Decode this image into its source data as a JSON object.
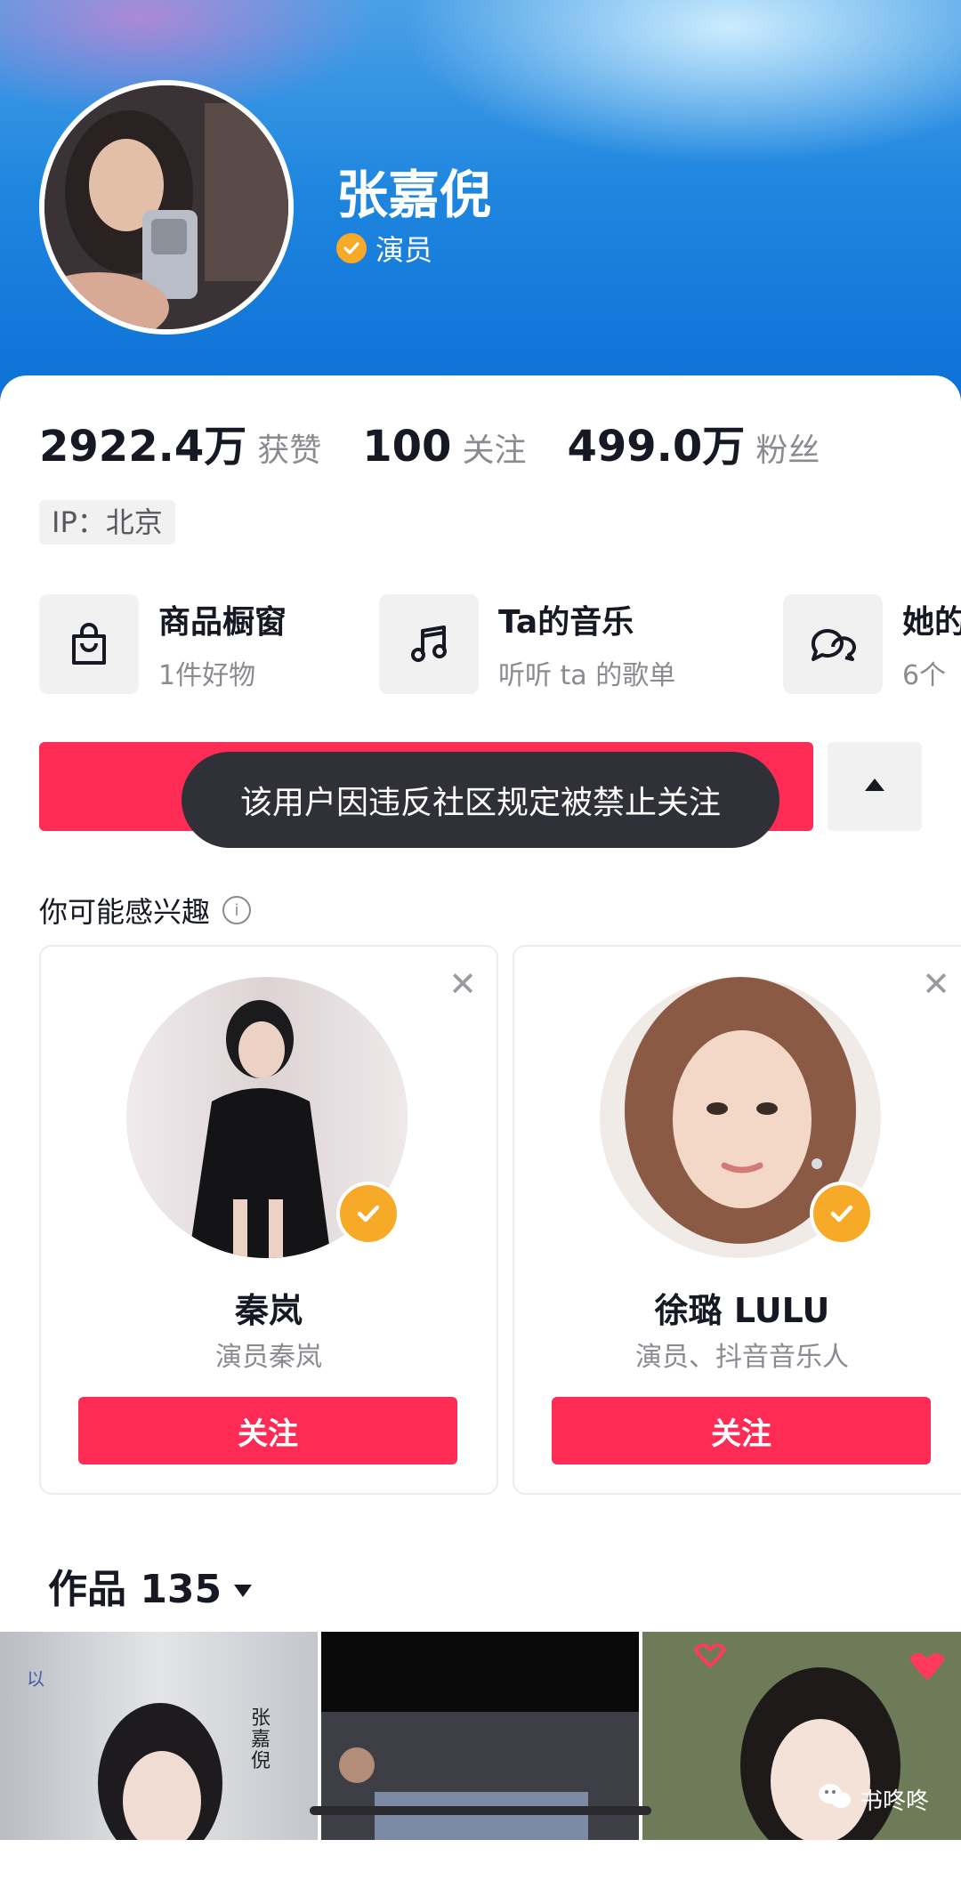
{
  "profile": {
    "name": "张嘉倪",
    "verified_label": "演员"
  },
  "stats": {
    "likes_num": "2922.4万",
    "likes_label": "获赞",
    "following_num": "100",
    "following_label": "关注",
    "followers_num": "499.0万",
    "followers_label": "粉丝"
  },
  "ip": "IP：北京",
  "features": [
    {
      "title": "商品橱窗",
      "sub": "1件好物",
      "icon": "shopping-bag-icon"
    },
    {
      "title": "Ta的音乐",
      "sub": "听听 ta 的歌单",
      "icon": "music-note-icon"
    },
    {
      "title": "她的",
      "sub": "6个",
      "icon": "chat-bubbles-icon"
    }
  ],
  "toast": "该用户因违反社区规定被禁止关注",
  "recommend": {
    "title": "你可能感兴趣",
    "cards": [
      {
        "name": "秦岚",
        "sub": "演员秦岚",
        "follow": "关注"
      },
      {
        "name": "徐璐 LULU",
        "sub": "演员、抖音音乐人",
        "follow": "关注"
      }
    ]
  },
  "works": {
    "label": "作品 135"
  },
  "thumb1_text": "张嘉倪",
  "watermark": "书咚咚",
  "colors": {
    "accent": "#fe2c55",
    "verify": "#f7a928",
    "header_blue": "#1f86df"
  }
}
